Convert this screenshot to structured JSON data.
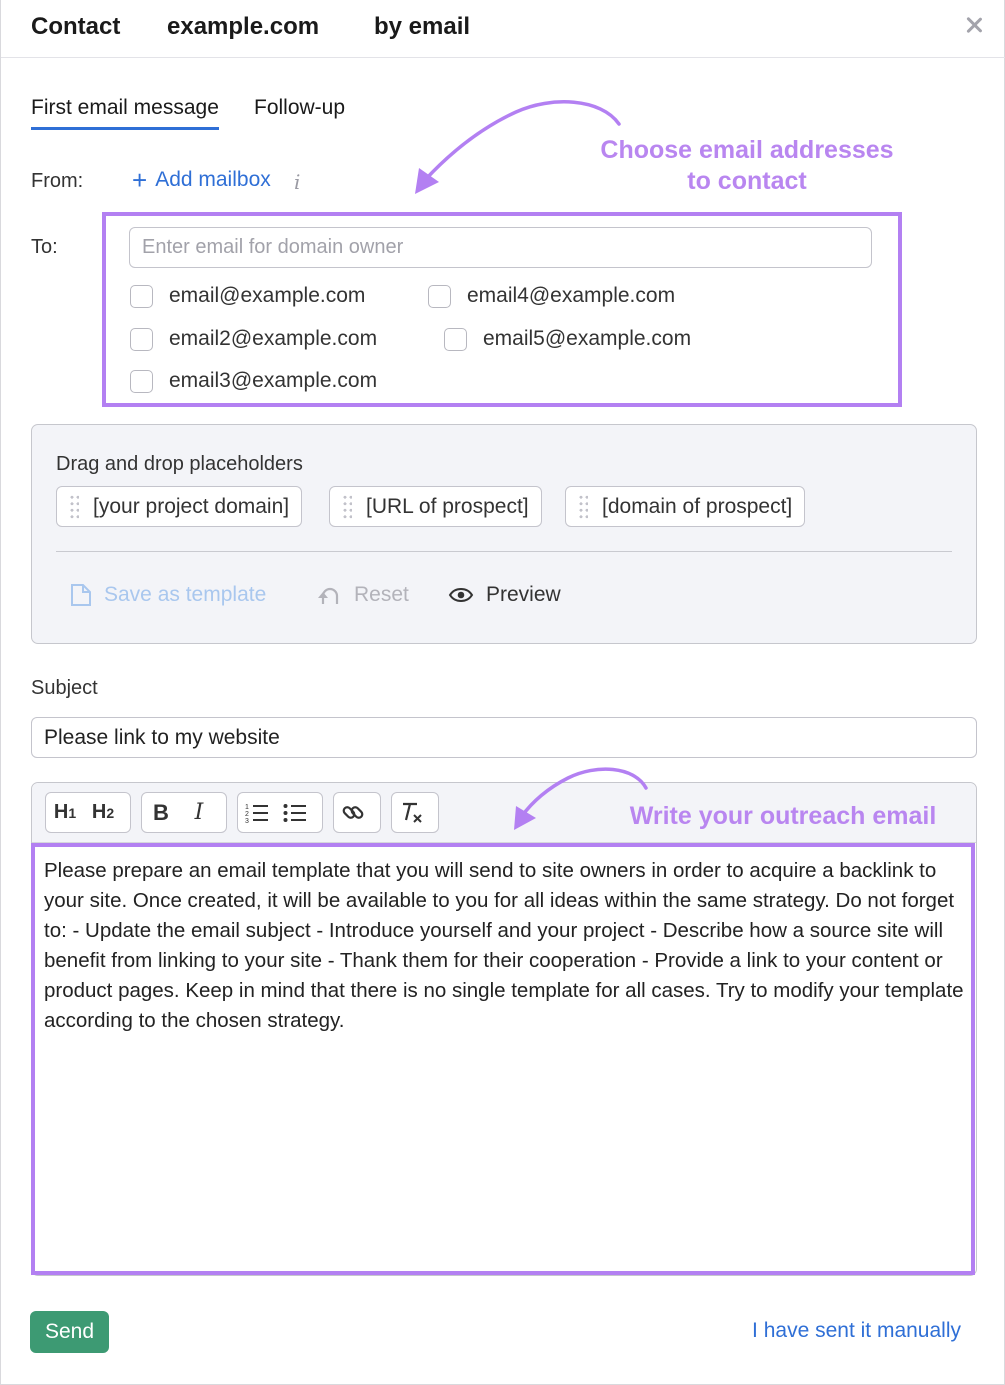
{
  "header": {
    "title_part1": "Contact",
    "title_part2": "example.com",
    "title_part3": "by email"
  },
  "tabs": [
    {
      "label": "First email message",
      "active": true
    },
    {
      "label": "Follow-up",
      "active": false
    }
  ],
  "from": {
    "label": "From:",
    "add_mailbox": "Add mailbox"
  },
  "to": {
    "label": "To:",
    "placeholder": "Enter email for domain owner",
    "emails": [
      "email@example.com",
      "email2@example.com",
      "email3@example.com",
      "email4@example.com",
      "email5@example.com"
    ]
  },
  "annotations": {
    "choose_line1": "Choose email addresses",
    "choose_line2": "to contact",
    "write": "Write your outreach email",
    "color": "#b380f2"
  },
  "placeholders": {
    "title": "Drag and drop placeholders",
    "chips": [
      "[your project domain]",
      "[URL of prospect]",
      "[domain of prospect]"
    ],
    "save_template": "Save as template",
    "reset": "Reset",
    "preview": "Preview"
  },
  "subject": {
    "label": "Subject",
    "value": "Please link to my website"
  },
  "editor": {
    "toolbar": {
      "h1": "H",
      "h1_sub": "1",
      "h2": "H",
      "h2_sub": "2",
      "bold": "B",
      "italic": "I"
    },
    "body": "Please prepare an email template that you will send to site owners in order to acquire a backlink to your site. Once created, it will be available to you for all ideas within the same strategy. Do not forget to: - Update the email subject - Introduce yourself and your project - Describe how a source site will benefit from linking to your site - Thank them for their cooperation - Provide a link to your content or product pages. Keep in mind that there is no single template for all cases. Try to modify your template according to the chosen strategy."
  },
  "footer": {
    "send": "Send",
    "sent_manually": "I have sent it manually"
  },
  "colors": {
    "accent_blue": "#2f6fd6",
    "send_green": "#3d9a73",
    "highlight_purple": "#b380f2"
  }
}
